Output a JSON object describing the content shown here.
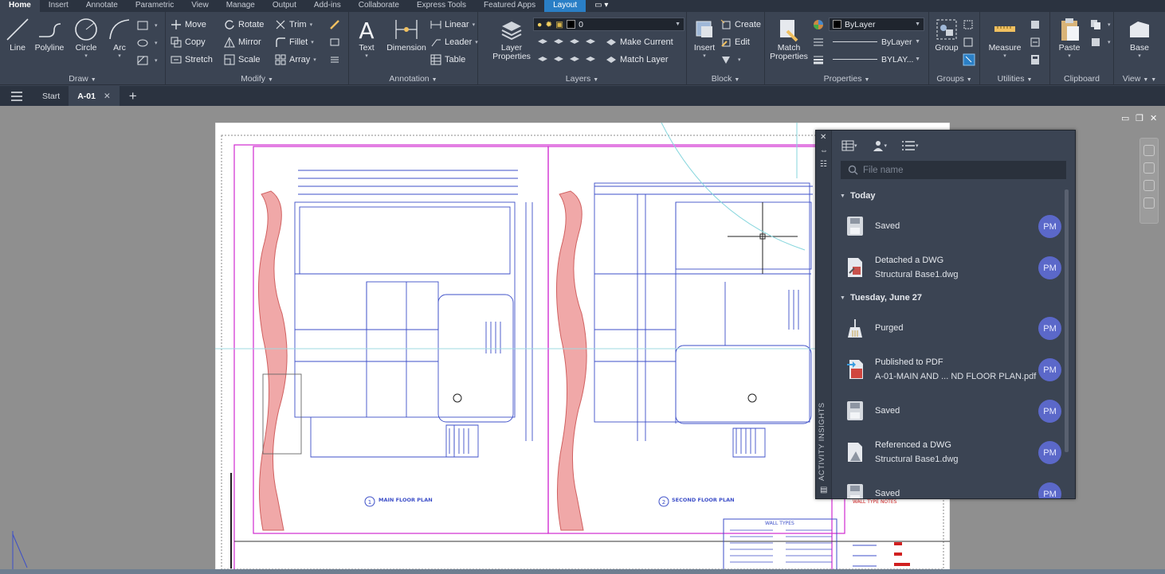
{
  "ribbon_tabs": [
    {
      "label": "Home",
      "state": "active"
    },
    {
      "label": "Insert",
      "state": ""
    },
    {
      "label": "Annotate",
      "state": ""
    },
    {
      "label": "Parametric",
      "state": ""
    },
    {
      "label": "View",
      "state": ""
    },
    {
      "label": "Manage",
      "state": ""
    },
    {
      "label": "Output",
      "state": ""
    },
    {
      "label": "Add-ins",
      "state": ""
    },
    {
      "label": "Collaborate",
      "state": ""
    },
    {
      "label": "Express Tools",
      "state": ""
    },
    {
      "label": "Featured Apps",
      "state": ""
    },
    {
      "label": "Layout",
      "state": "layout"
    },
    {
      "label": "▭ ▾",
      "state": "extra"
    }
  ],
  "draw": {
    "title": "Draw",
    "line": "Line",
    "polyline": "Polyline",
    "circle": "Circle",
    "arc": "Arc"
  },
  "modify": {
    "title": "Modify",
    "move": "Move",
    "rotate": "Rotate",
    "trim": "Trim",
    "copy": "Copy",
    "mirror": "Mirror",
    "fillet": "Fillet",
    "stretch": "Stretch",
    "scale": "Scale",
    "array": "Array"
  },
  "annotation": {
    "title": "Annotation",
    "text": "Text",
    "dimension": "Dimension",
    "linear": "Linear",
    "leader": "Leader",
    "table": "Table"
  },
  "layers": {
    "title": "Layers",
    "layer_properties": "Layer Properties",
    "current_layer": "0",
    "make_current": "Make Current",
    "match_layer": "Match Layer"
  },
  "block": {
    "title": "Block",
    "insert": "Insert",
    "create": "Create",
    "edit": "Edit"
  },
  "properties": {
    "title": "Properties",
    "match_properties": "Match Properties",
    "color": "ByLayer",
    "linetype": "ByLayer",
    "lineweight": "BYLAY..."
  },
  "groups": {
    "title": "Groups",
    "group": "Group"
  },
  "utilities": {
    "title": "Utilities",
    "measure": "Measure"
  },
  "clipboard": {
    "title": "Clipboard",
    "paste": "Paste"
  },
  "view": {
    "title": "View",
    "base": "Base"
  },
  "file_tabs": {
    "start": "Start",
    "active": "A-01"
  },
  "drawing": {
    "plan1_label": "MAIN FLOOR PLAN",
    "plan2_label": "SECOND FLOOR PLAN",
    "plan1_number": "1",
    "plan2_number": "2",
    "wall_types": "WALL TYPES",
    "wall_type_notes": "WALL TYPE NOTES"
  },
  "activity_insights": {
    "panel_title": "ACTIVITY INSIGHTS",
    "search_placeholder": "File name",
    "groups": [
      {
        "label": "Today",
        "items": [
          {
            "action": "Saved",
            "detail": "",
            "user": "PM",
            "icon": "save-icon"
          },
          {
            "action": "Detached a DWG",
            "detail": "Structural Base1.dwg",
            "user": "PM",
            "icon": "detach-dwg-icon"
          }
        ]
      },
      {
        "label": "Tuesday, June 27",
        "items": [
          {
            "action": "Purged",
            "detail": "",
            "user": "PM",
            "icon": "purge-icon"
          },
          {
            "action": "Published to PDF",
            "detail": "A-01-MAIN AND ... ND FLOOR PLAN.pdf",
            "user": "PM",
            "icon": "pdf-icon"
          },
          {
            "action": "Saved",
            "detail": "",
            "user": "PM",
            "icon": "save-icon"
          },
          {
            "action": "Referenced a DWG",
            "detail": "Structural Base1.dwg",
            "user": "PM",
            "icon": "reference-dwg-icon"
          },
          {
            "action": "Saved",
            "detail": "",
            "user": "PM",
            "icon": "save-icon"
          }
        ]
      }
    ]
  },
  "colors": {
    "ribbon_bg": "#3b4453",
    "tab_bar": "#2b3340",
    "layout_tab": "#2a7fc6",
    "avatar": "#5b68c9",
    "canvas": "#8f8f8f",
    "wall_hatch": "#f0a8a8",
    "plan_lines": "#3d4fc8",
    "border_magenta": "#d02ad0"
  }
}
